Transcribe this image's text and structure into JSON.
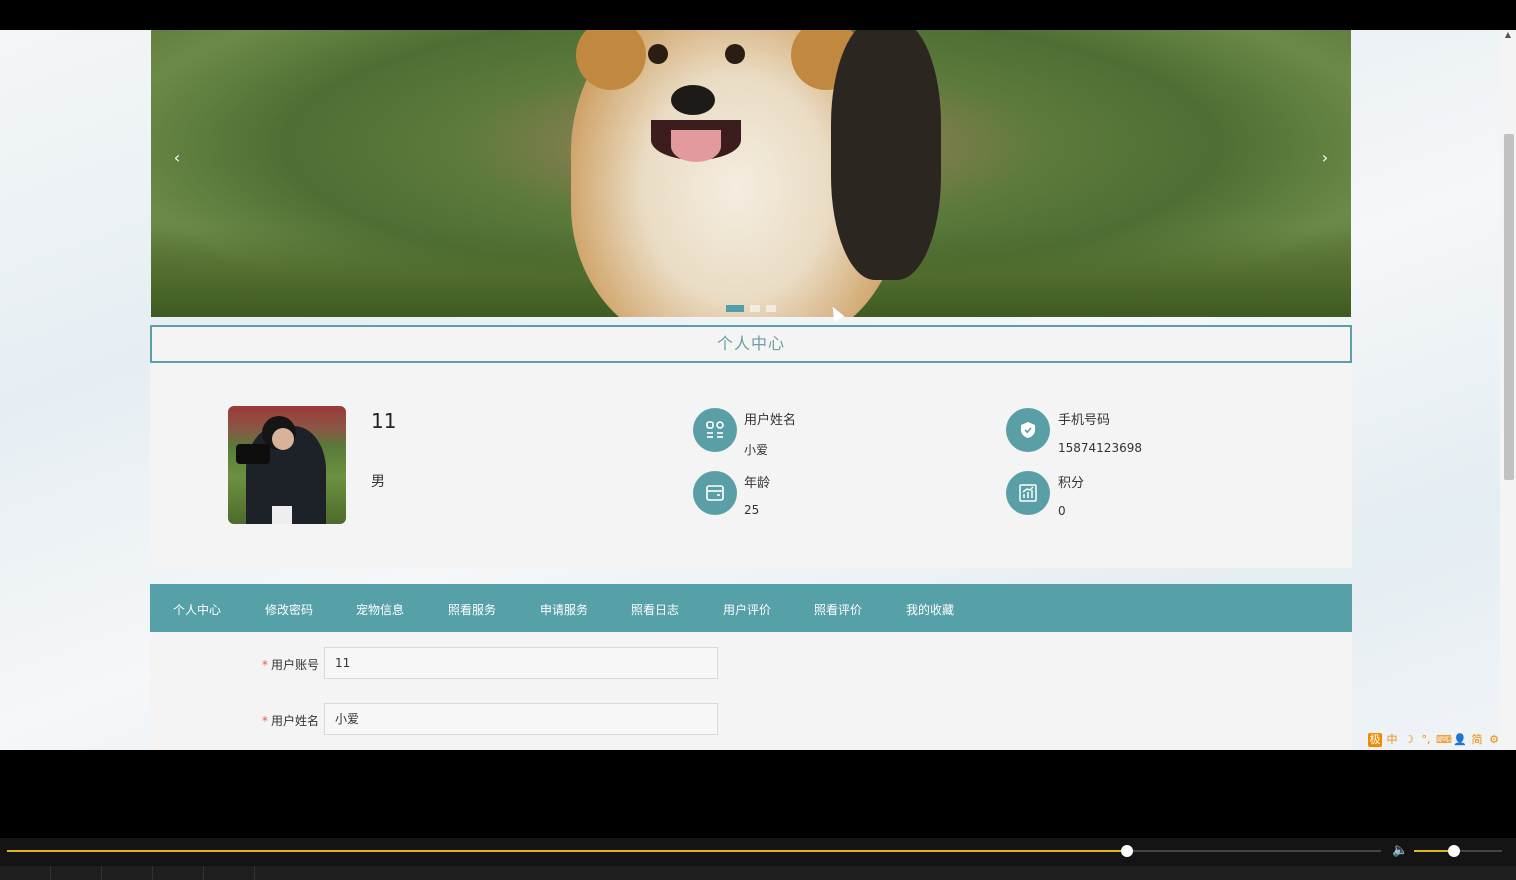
{
  "banner": {
    "prev_arrow": "‹",
    "next_arrow": "›",
    "slide_count": 3,
    "active_slide": 1
  },
  "section_title": "个人中心",
  "profile": {
    "account": "11",
    "gender": "男",
    "stats": [
      {
        "label": "用户姓名",
        "value": "小爱",
        "icon": "apps-grid-icon"
      },
      {
        "label": "手机号码",
        "value": "15874123698",
        "icon": "shield-check-icon"
      },
      {
        "label": "年龄",
        "value": "25",
        "icon": "wallet-icon"
      },
      {
        "label": "积分",
        "value": "0",
        "icon": "chart-icon"
      }
    ]
  },
  "tabs": [
    {
      "label": "个人中心",
      "active": true
    },
    {
      "label": "修改密码"
    },
    {
      "label": "宠物信息"
    },
    {
      "label": "照看服务"
    },
    {
      "label": "申请服务"
    },
    {
      "label": "照看日志"
    },
    {
      "label": "用户评价"
    },
    {
      "label": "照看评价"
    },
    {
      "label": "我的收藏"
    }
  ],
  "form": {
    "fields": [
      {
        "required_mark": "*",
        "label": "用户账号",
        "value": "11"
      },
      {
        "required_mark": "*",
        "label": "用户姓名",
        "value": "小爱"
      }
    ]
  },
  "ime_toolbar": [
    "极",
    "中",
    "☽",
    "°,",
    "⌨",
    "👤",
    "简",
    "⚙"
  ],
  "player": {
    "progress": 0.815,
    "volume": 0.45,
    "colors": {
      "accent": "#e2b620"
    }
  },
  "colors": {
    "primary": "#56a0a8",
    "title_text": "#6b9ea4"
  }
}
